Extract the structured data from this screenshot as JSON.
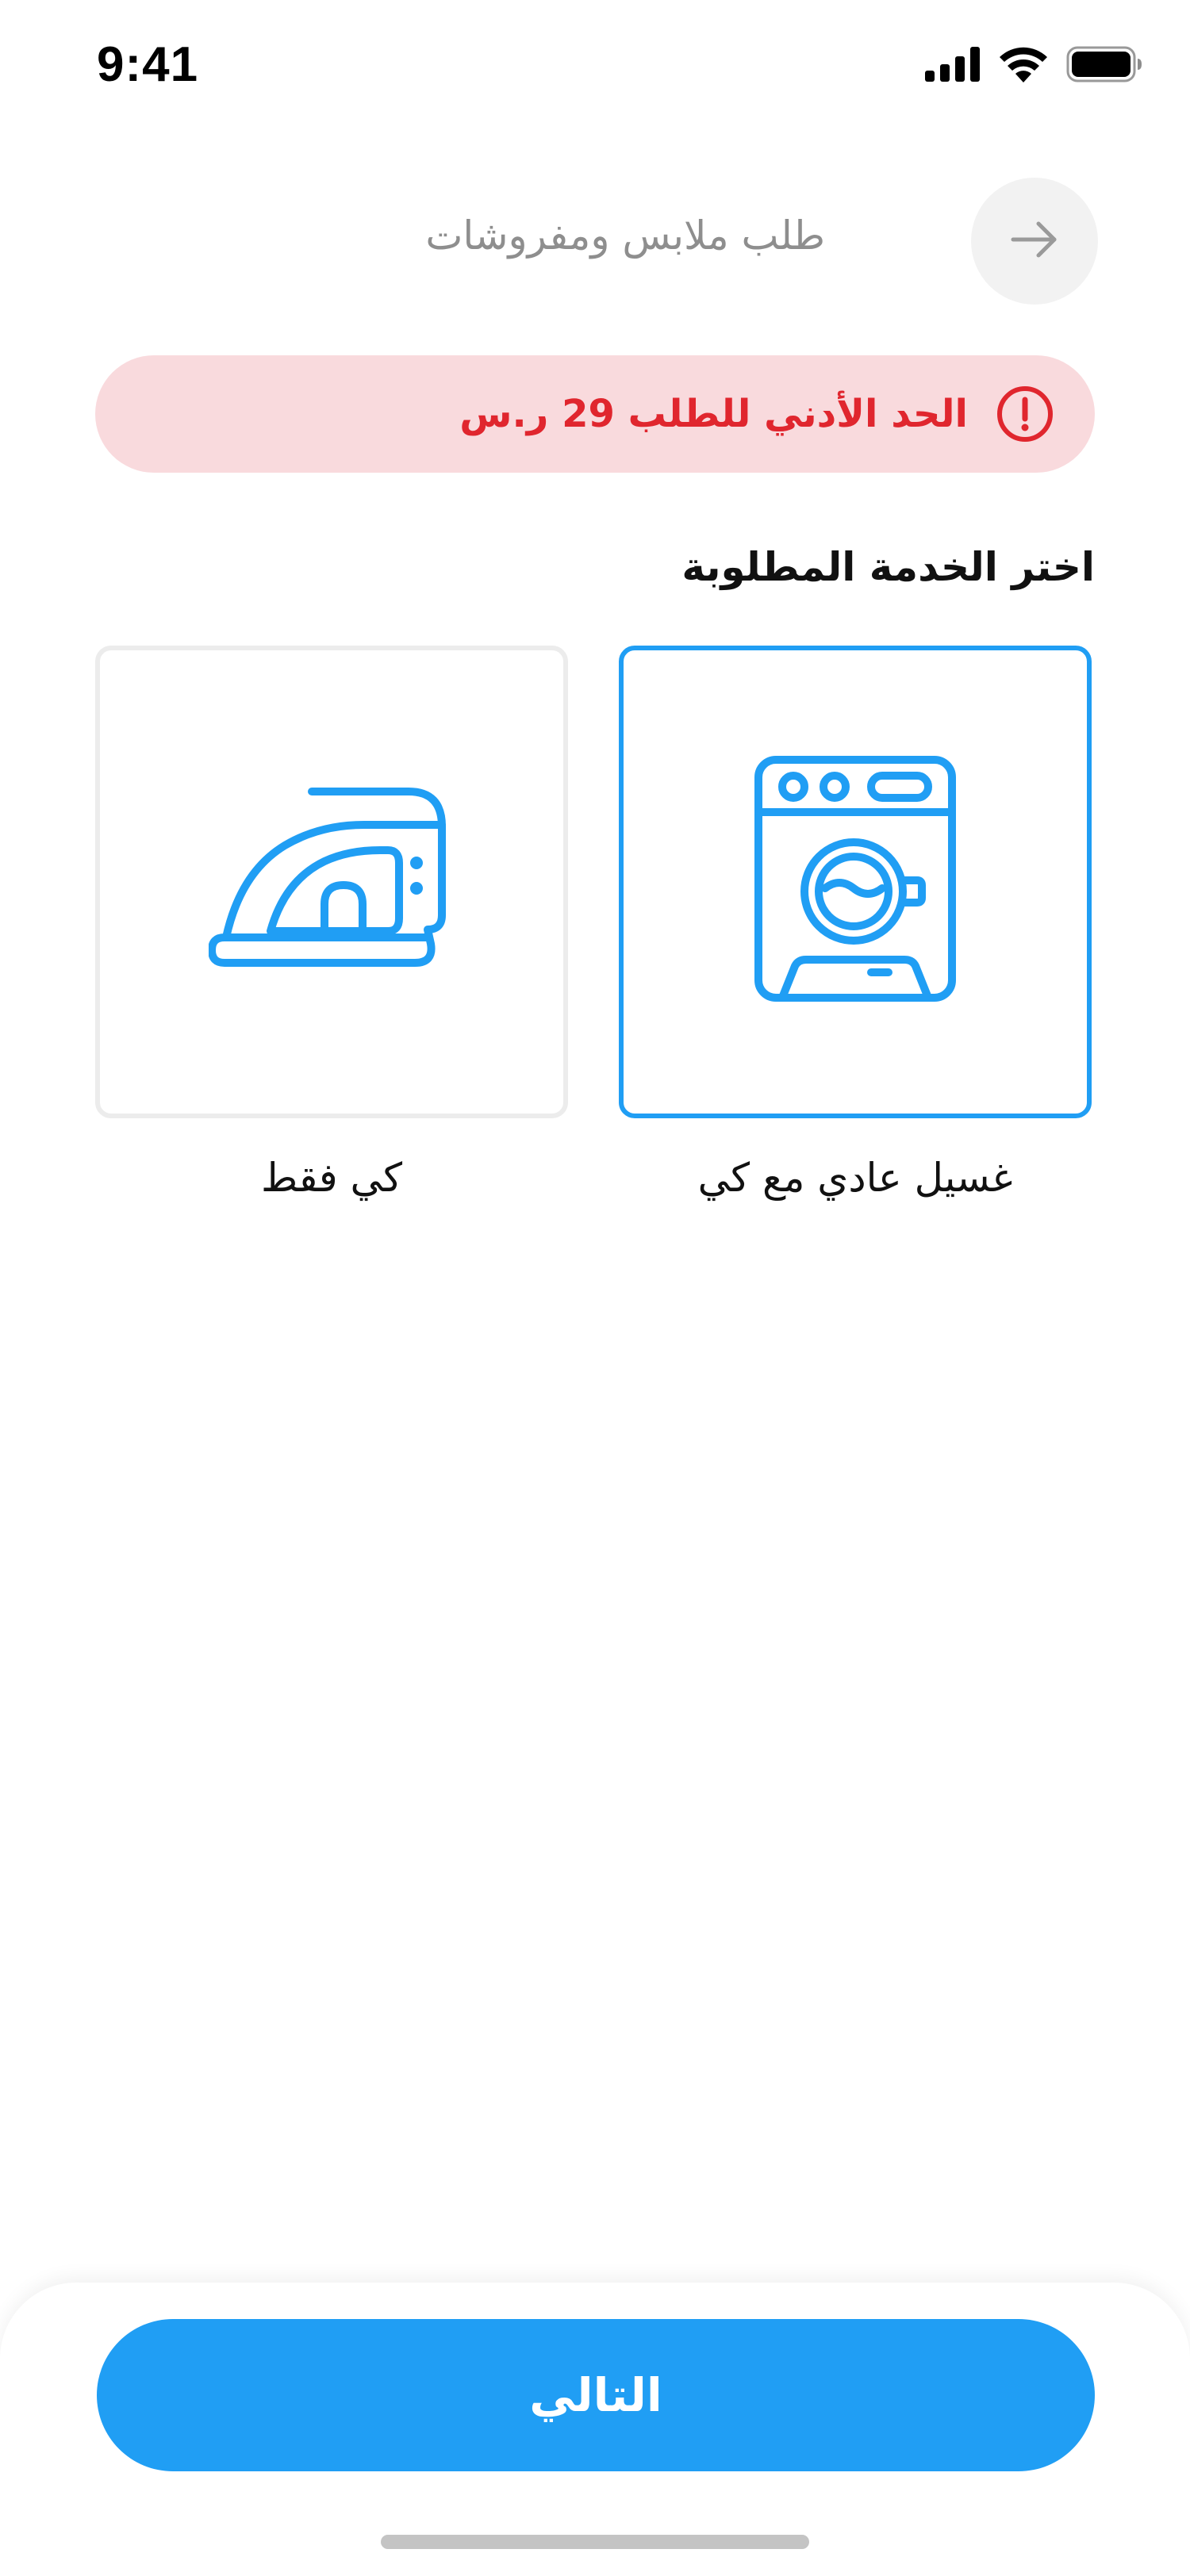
{
  "status_bar": {
    "time": "9:41",
    "icons": [
      "cellular-signal-icon",
      "wifi-icon",
      "battery-icon"
    ]
  },
  "header": {
    "title": "طلب ملابس ومفروشات",
    "back_icon": "arrow-right-icon"
  },
  "alert": {
    "icon": "exclamation-circle-icon",
    "text": "الحد الأدني للطلب 29 ر.س",
    "color": "#e0262e",
    "background": "#f9dadd"
  },
  "section": {
    "heading": "اختر الخدمة المطلوبة"
  },
  "services": [
    {
      "label": "غسيل عادي مع كي",
      "icon": "washing-machine-icon",
      "selected": true
    },
    {
      "label": "كي فقط",
      "icon": "iron-icon",
      "selected": false
    }
  ],
  "footer": {
    "next_label": "التالي"
  },
  "colors": {
    "accent": "#209ef4",
    "alert_red": "#e0262e",
    "muted_text": "#8e8e8e",
    "card_border": "#ececec"
  }
}
